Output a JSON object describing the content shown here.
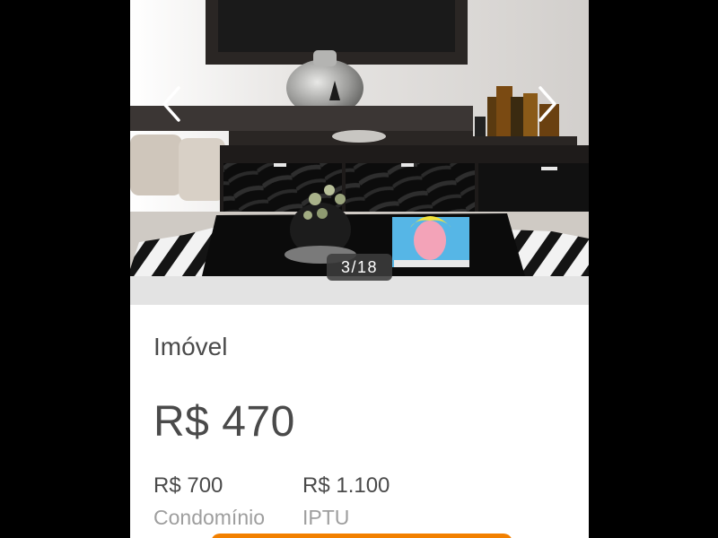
{
  "gallery": {
    "counter": "3/18",
    "prev_icon": "chevron-left-icon",
    "next_icon": "chevron-right-icon"
  },
  "listing": {
    "category": "Imóvel",
    "price": "R$ 470",
    "fees": [
      {
        "value": "R$ 700",
        "label": "Condomínio"
      },
      {
        "value": "R$ 1.100",
        "label": "IPTU"
      }
    ]
  },
  "colors": {
    "background": "#000000",
    "card": "#ffffff",
    "text_primary": "#4a4a4a",
    "text_secondary": "#9e9e9e",
    "accent": "#f28000"
  }
}
